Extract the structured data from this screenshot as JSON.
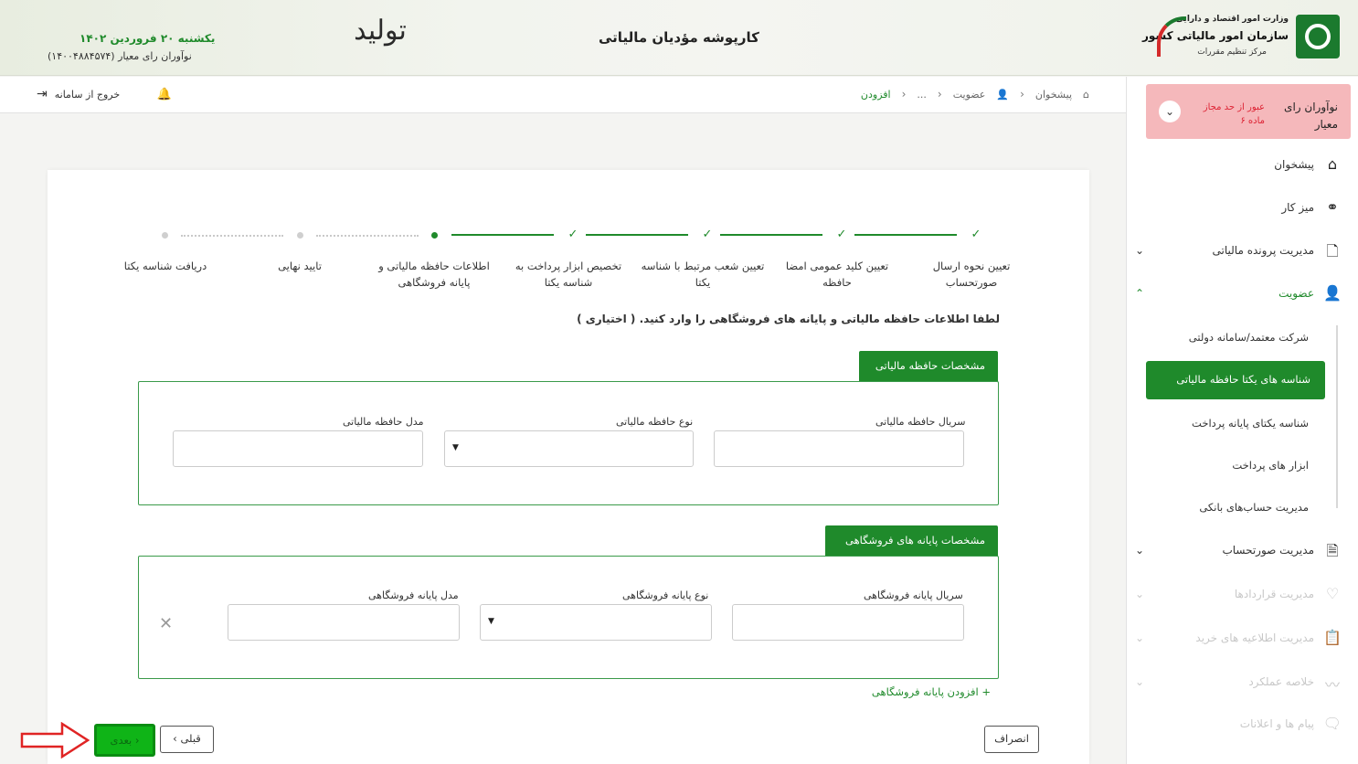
{
  "header": {
    "ministry_line1": "وزارت امور اقتصاد و دارایی",
    "ministry_line2": "سازمان امور مالیاتی کشور",
    "ministry_line3": "مرکز تنظیم مقررات",
    "app_title": "کارپوشه مؤدیان مالیاتی",
    "slogan": "تولید",
    "date": "یکشنبه ۲۰ فروردین ۱۴۰۲",
    "user": "نوآوران رای معیار (۱۴۰۰۴۸۸۴۵۷۴)"
  },
  "topbar": {
    "breadcrumb": [
      "پیشخوان",
      "عضویت",
      "...",
      "افزودن"
    ],
    "logout_label": "خروج از سامانه"
  },
  "sidebar": {
    "alert": {
      "name": "نوآوران رای معیار",
      "warning": "عبور از حد مجاز ماده ۶"
    },
    "items": [
      {
        "label": "پیشخوان",
        "icon": "home-icon"
      },
      {
        "label": "میز کار",
        "icon": "workflow-icon"
      },
      {
        "label": "مدیریت پرونده مالیاتی",
        "icon": "file-icon"
      },
      {
        "label": "عضویت",
        "icon": "user-icon"
      },
      {
        "label": "مدیریت صورتحساب",
        "icon": "invoice-icon"
      },
      {
        "label": "مدیریت قراردادها",
        "icon": "handshake-icon"
      },
      {
        "label": "مدیریت اطلاعیه های خرید",
        "icon": "clipboard-icon"
      },
      {
        "label": "خلاصه عملکرد",
        "icon": "chart-icon"
      },
      {
        "label": "پیام ها و اعلانات",
        "icon": "message-icon"
      }
    ],
    "sub_items": [
      "شرکت معتمد/سامانه دولتی",
      "شناسه های یکتا حافظه مالیاتی",
      "شناسه یکتای پایانه پرداخت",
      "ابزار های پرداخت",
      "مدیریت حساب‌های بانکی"
    ]
  },
  "steps": [
    {
      "label_l1": "تعیین نحوه ارسال",
      "label_l2": "صورتحساب",
      "state": "done"
    },
    {
      "label_l1": "تعیین کلید عمومی امضا",
      "label_l2": "حافظه",
      "state": "done"
    },
    {
      "label_l1": "تعیین شعب مرتبط با شناسه",
      "label_l2": "یکتا",
      "state": "done"
    },
    {
      "label_l1": "تخصیص ابزار پرداخت به",
      "label_l2": "شناسه یکتا",
      "state": "done"
    },
    {
      "label_l1": "اطلاعات حافظه مالیاتی و",
      "label_l2": "پایانه فروشگاهی",
      "state": "current"
    },
    {
      "label_l1": "تایید نهایی",
      "label_l2": "",
      "state": "pending"
    },
    {
      "label_l1": "دریافت شناسه یکتا",
      "label_l2": "",
      "state": "pending"
    }
  ],
  "form": {
    "instruction": "لطفا اطلاعات حافظه مالیاتی و پایانه های فروشگاهی را وارد کنید. ( اختیاری )",
    "memory_section": {
      "title": "مشخصات حافظه مالیاتی",
      "serial_label": "سریال حافظه مالیاتی",
      "type_label": "نوع حافظه مالیاتی",
      "model_label": "مدل حافظه مالیاتی"
    },
    "terminal_section": {
      "title": "مشخصات پایانه های فروشگاهی",
      "serial_label": "سریال پایانه فروشگاهی",
      "type_label": "نوع پایانه فروشگاهی",
      "model_label": "مدل پایانه فروشگاهی"
    },
    "add_terminal": "+ افزودن پایانه فروشگاهی"
  },
  "buttons": {
    "cancel": "انصراف",
    "prev": "قبلی",
    "next": "بعدی"
  },
  "colors": {
    "primary": "#1f8a2b",
    "alert_bg": "#f5b8bb",
    "highlight": "#0fb417"
  }
}
